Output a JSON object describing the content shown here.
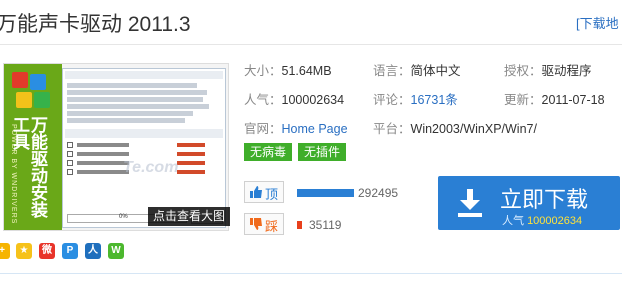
{
  "header": {
    "title": "万能声卡驱动 2011.3",
    "download_link": "[下载地"
  },
  "thumbnail": {
    "side_title": "万能驱动安装工具",
    "side_subtitle": "POWER BY WNDRIVERS",
    "watermark": "Te.com",
    "progress_text": "0%",
    "view_large_label": "点击查看大图"
  },
  "info": {
    "size_label": "大小：",
    "size_value": "51.64MB",
    "language_label": "语言：",
    "language_value": "简体中文",
    "license_label": "授权：",
    "license_value": "驱动程序",
    "popularity_label": "人气：",
    "popularity_value": "100002634",
    "reviews_label": "评论：",
    "reviews_value": "16731条",
    "updated_label": "更新：",
    "updated_value": "2011-07-18",
    "website_label": "官网：",
    "website_value": "Home Page",
    "platform_label": "平台：",
    "platform_value": "Win2003/WinXP/Win7/"
  },
  "tags": [
    "无病毒",
    "无插件"
  ],
  "votes": {
    "up_label": "顶",
    "up_count": "292495",
    "down_label": "踩",
    "down_count": "35119",
    "up_fraction": 0.89,
    "down_fraction": 0.11
  },
  "download_button": {
    "label": "立即下载",
    "sub_label": "人气",
    "sub_value": "100002634"
  },
  "colors": {
    "accent_blue": "#2a7fd4",
    "tag_green": "#3fae2a",
    "down_orange": "#f06a1c"
  },
  "share_icons": [
    "qzone-icon",
    "star-icon",
    "weibo-icon",
    "pengyou-icon",
    "renren-icon",
    "wechat-icon"
  ]
}
